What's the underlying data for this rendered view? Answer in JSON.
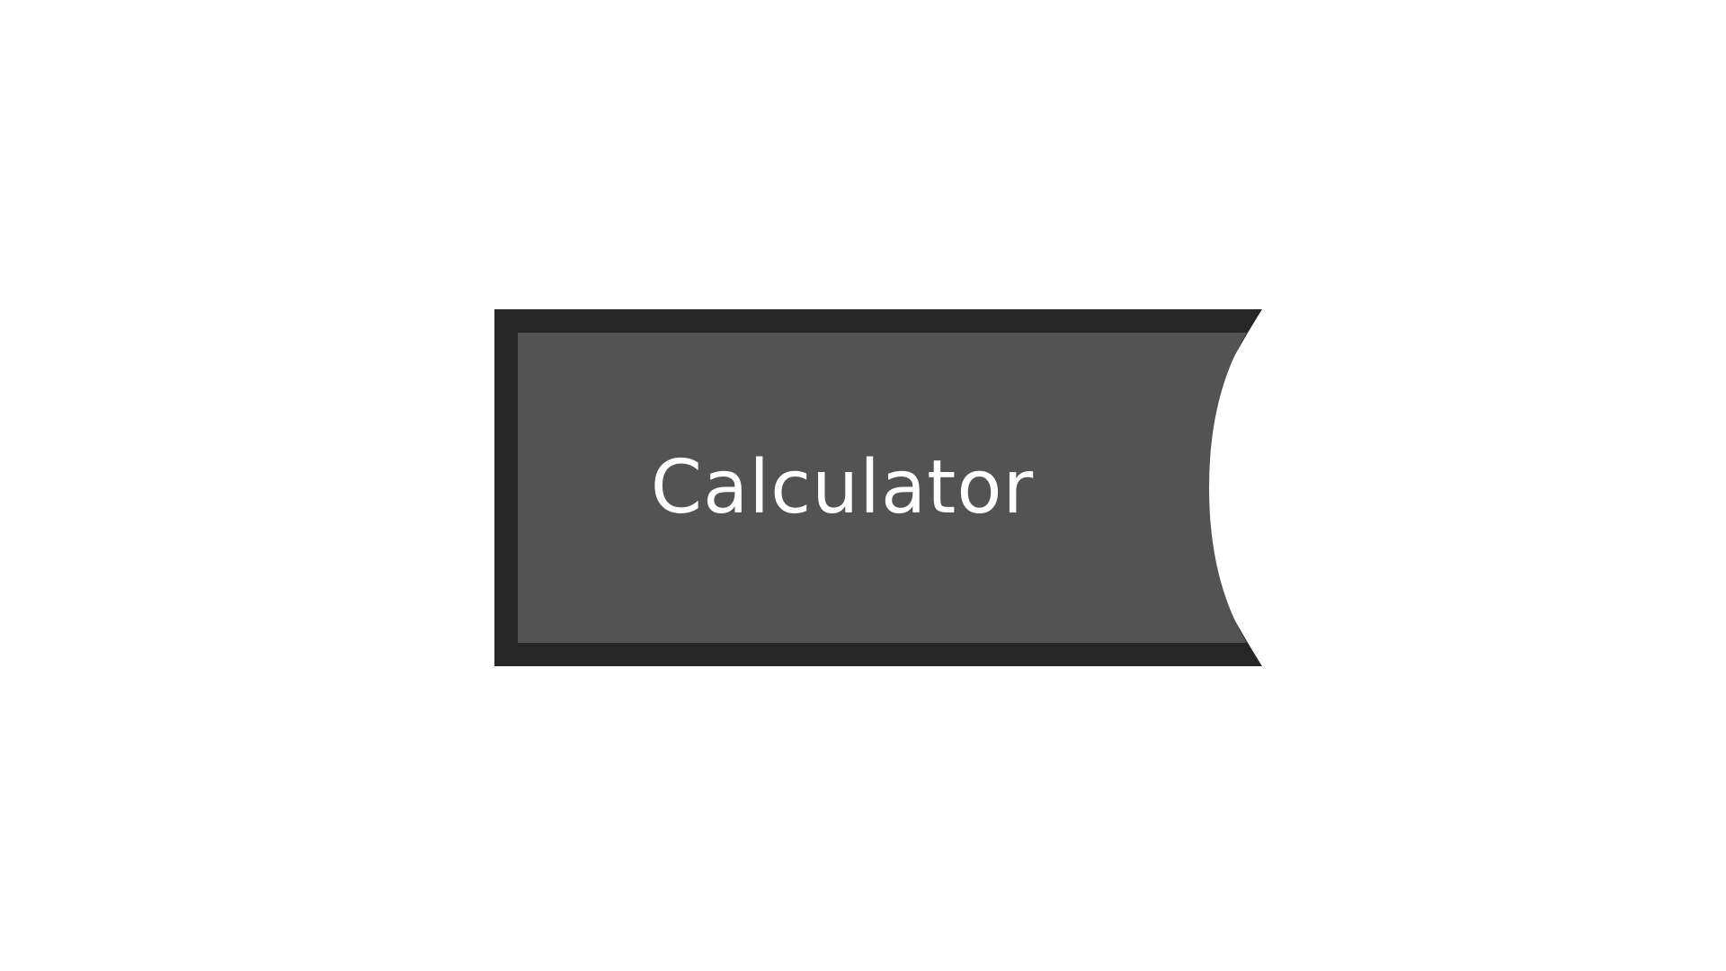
{
  "app_tile": {
    "label": "Calculator",
    "colors": {
      "border": "#262626",
      "fill": "#535353",
      "label": "#ffffff",
      "background": "#ffffff"
    }
  }
}
